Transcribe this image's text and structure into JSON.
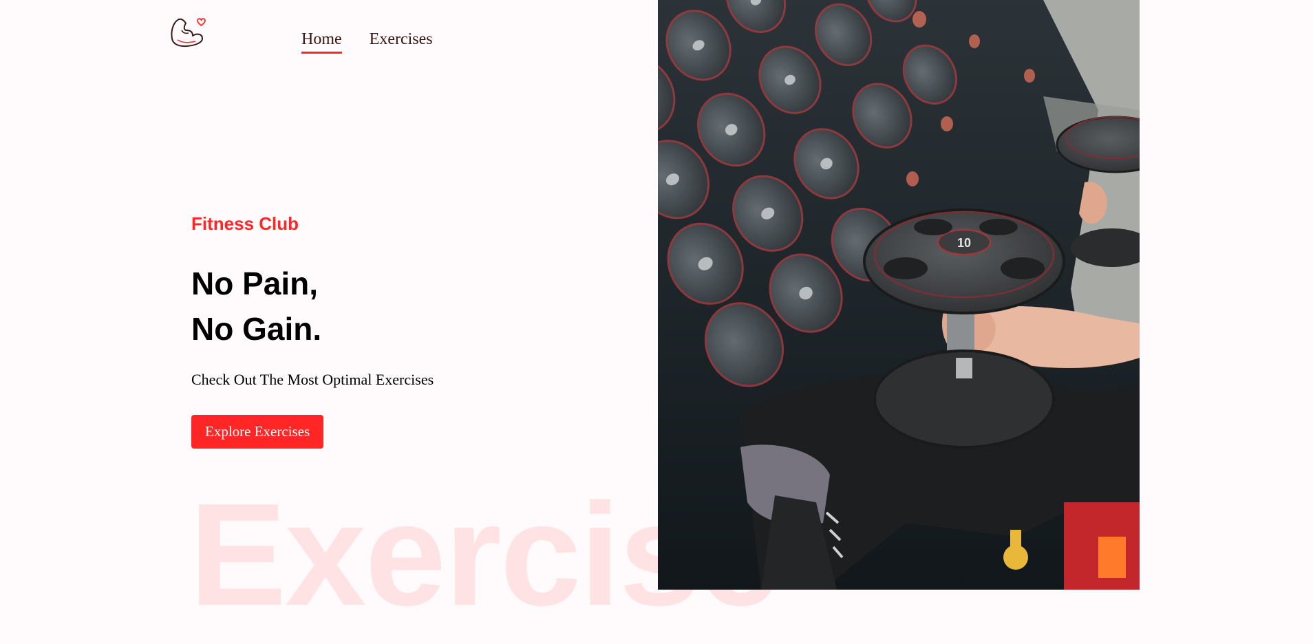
{
  "nav": {
    "items": [
      {
        "label": "Home",
        "active": true
      },
      {
        "label": "Exercises",
        "active": false
      }
    ]
  },
  "hero": {
    "tagline": "Fitness Club",
    "headline_line1": "No Pain,",
    "headline_line2": "No Gain.",
    "subtitle": "Check Out The Most Optimal Exercises",
    "cta_label": "Explore Exercises",
    "watermark": "Exercise"
  },
  "banner": {
    "plate_label": "10"
  },
  "colors": {
    "accent": "#ff2625",
    "background": "#fffafb",
    "nav_text": "#3a1212"
  },
  "icons": {
    "logo": "flexed-arm-heart-icon"
  }
}
